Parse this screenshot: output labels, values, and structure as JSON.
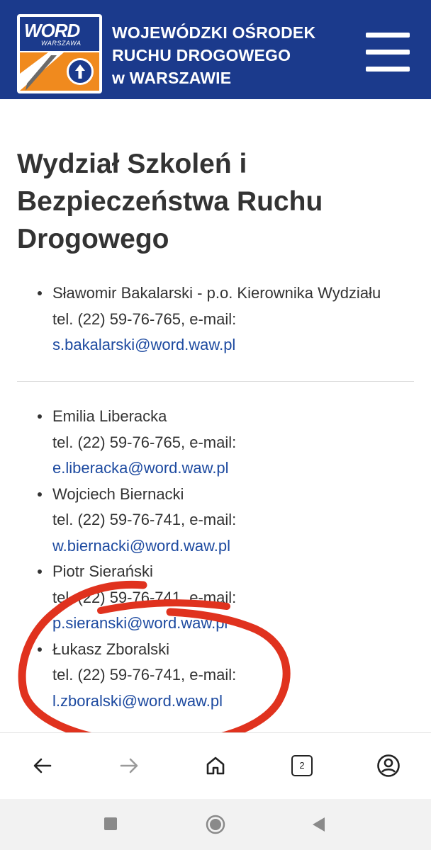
{
  "header": {
    "logo_word": "WORD",
    "logo_city": "WARSZAWA",
    "org_lines": [
      "WOJEWÓDZKI OŚRODEK",
      "RUCHU DROGOWEGO",
      "w WARSZAWIE"
    ],
    "menu_icon": "hamburger-menu-icon",
    "brand_color": "#1b3a8c",
    "accent_color": "#f08a1e"
  },
  "page": {
    "title": "Wydział Szkoleń i Bezpieczeństwa Ruchu Drogowego"
  },
  "manager": [
    {
      "name_role": "Sławomir Bakalarski - p.o. Kierownika Wydziału",
      "phone_line": "tel. (22) 59-76-765, e-mail:",
      "email": "s.bakalarski@word.waw.pl"
    }
  ],
  "staff": [
    {
      "name": "Emilia Liberacka",
      "phone_line": "tel. (22) 59-76-765, e-mail:",
      "email": "e.liberacka@word.waw.pl"
    },
    {
      "name": "Wojciech Biernacki",
      "phone_line": "tel. (22) 59-76-741, e-mail:",
      "email": "w.biernacki@word.waw.pl"
    },
    {
      "name": "Piotr Sierański",
      "phone_line": "tel. (22) 59-76-741, e-mail:",
      "email": "p.sieranski@word.waw.pl"
    },
    {
      "name": "Łukasz Zboralski",
      "phone_line": "tel. (22) 59-76-741, e-mail:",
      "email": "l.zboralski@word.waw.pl"
    }
  ],
  "browser_nav": {
    "icons": [
      "back-arrow-icon",
      "forward-arrow-icon",
      "home-icon",
      "tabs-icon",
      "account-icon"
    ],
    "tab_count": "2"
  },
  "system_nav": {
    "icons": [
      "recents-square-icon",
      "home-circle-icon",
      "back-triangle-icon"
    ]
  },
  "annotation": {
    "marker_color": "#e0321e"
  },
  "link_color": "#1d4aa0"
}
